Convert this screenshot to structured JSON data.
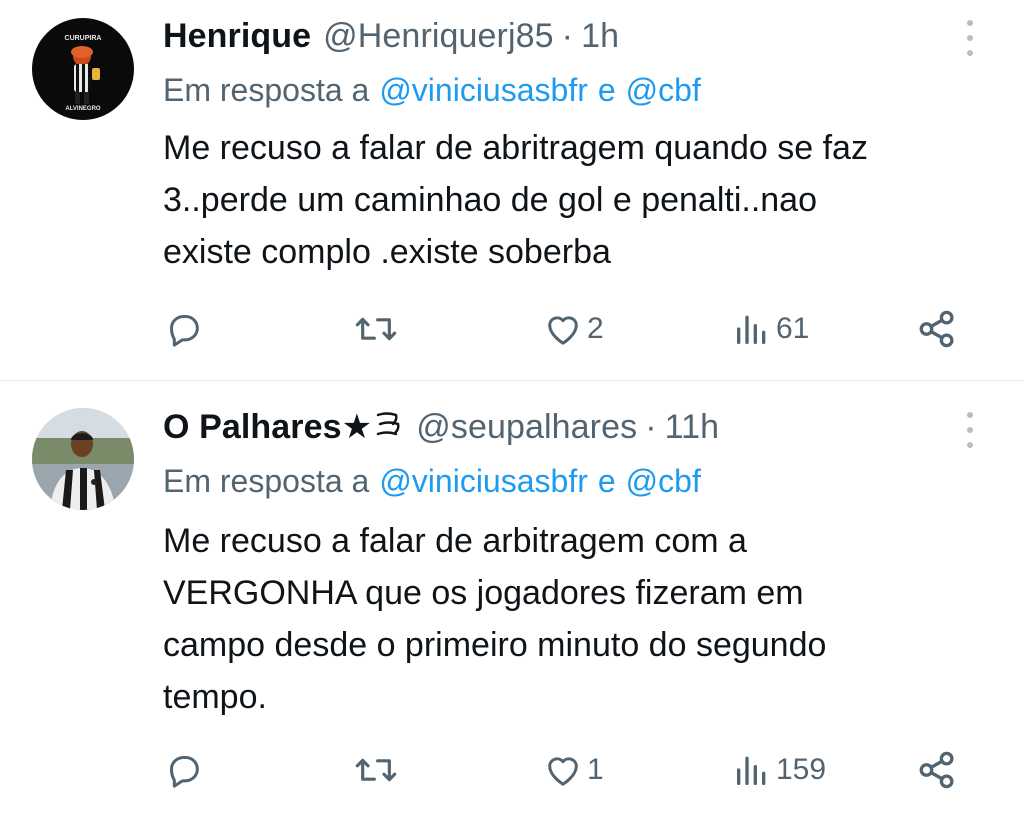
{
  "tweets": [
    {
      "name": "Henrique",
      "handle": "@Henriquerj85",
      "separator": "·",
      "time": "1h",
      "reply_prefix": "Em resposta a",
      "reply_mention_1": "@viniciusasbfr",
      "reply_and": "e",
      "reply_mention_2": "@cbf",
      "body_lines": [
        "Me recuso a falar de abritragem quando se faz",
        "3..perde um caminhao de gol e penalti..nao",
        "existe complo  .existe soberba"
      ],
      "likes": "2",
      "views": "61",
      "avatar_text_top": "CURUPIRA",
      "avatar_text_bottom": "ALVINEGRO"
    },
    {
      "name": "O Palhares★",
      "badge_icon": "wave-emoji-icon",
      "handle": "@seupalhares",
      "separator": "·",
      "time": "11h",
      "reply_prefix": "Em resposta a",
      "reply_mention_1": "@viniciusasbfr",
      "reply_and": "e",
      "reply_mention_2": "@cbf",
      "body_lines": [
        "Me recuso a falar de arbitragem com a",
        "VERGONHA que os jogadores fizeram em",
        "campo desde o primeiro minuto do segundo",
        "tempo."
      ],
      "likes": "1",
      "views": "159"
    }
  ],
  "colors": {
    "text": "#0f1419",
    "secondary": "#536471",
    "link": "#1d9bf0",
    "divider": "#e1e6ea"
  }
}
